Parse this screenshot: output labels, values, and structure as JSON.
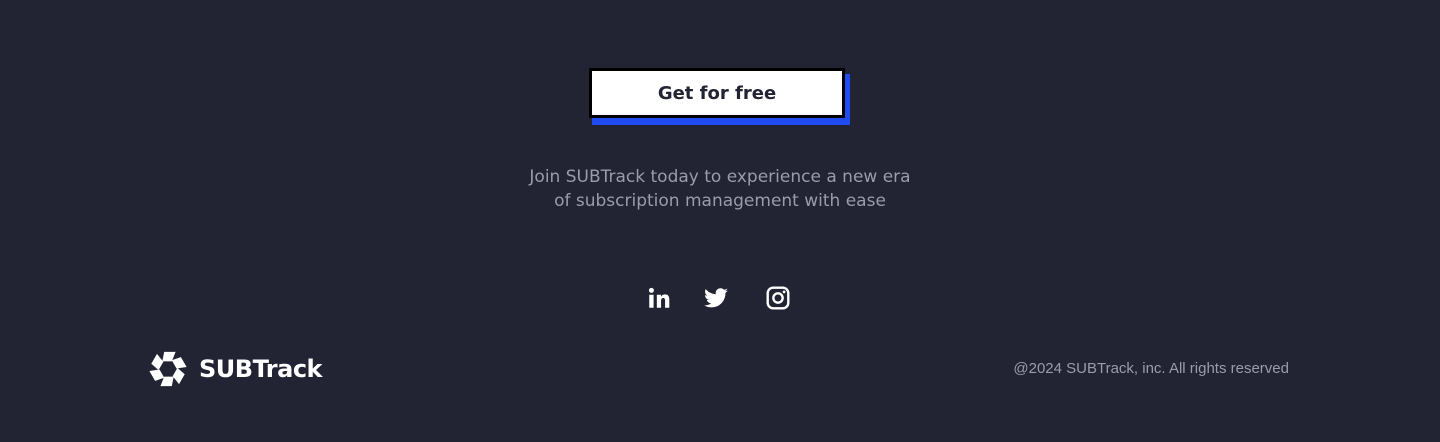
{
  "cta": {
    "label": "Get for free"
  },
  "tagline": {
    "line1": "Join SUBTrack today to experience a new era",
    "line2": "of subscription management with ease"
  },
  "social": {
    "icons": [
      "linkedin-icon",
      "twitter-icon",
      "instagram-icon"
    ]
  },
  "footer": {
    "brand": "SUBTrack",
    "copyright": "@2024 SUBTrack, inc. All rights reserved"
  },
  "colors": {
    "background": "#222333",
    "accent": "#1f4cf0",
    "muted_text": "#9a9bab"
  }
}
